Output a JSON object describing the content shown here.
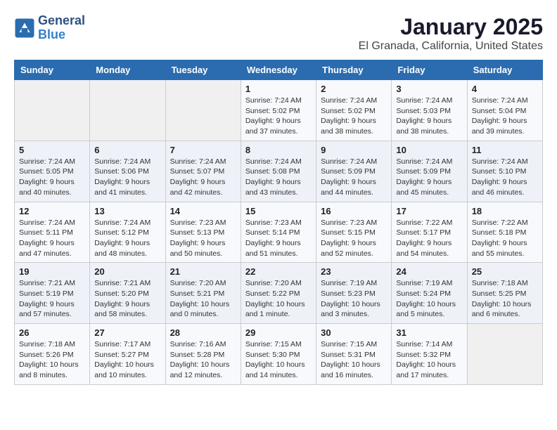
{
  "header": {
    "logo_line1": "General",
    "logo_line2": "Blue",
    "month": "January 2025",
    "location": "El Granada, California, United States"
  },
  "weekdays": [
    "Sunday",
    "Monday",
    "Tuesday",
    "Wednesday",
    "Thursday",
    "Friday",
    "Saturday"
  ],
  "weeks": [
    [
      {
        "day": "",
        "info": ""
      },
      {
        "day": "",
        "info": ""
      },
      {
        "day": "",
        "info": ""
      },
      {
        "day": "1",
        "info": "Sunrise: 7:24 AM\nSunset: 5:02 PM\nDaylight: 9 hours\nand 37 minutes."
      },
      {
        "day": "2",
        "info": "Sunrise: 7:24 AM\nSunset: 5:02 PM\nDaylight: 9 hours\nand 38 minutes."
      },
      {
        "day": "3",
        "info": "Sunrise: 7:24 AM\nSunset: 5:03 PM\nDaylight: 9 hours\nand 38 minutes."
      },
      {
        "day": "4",
        "info": "Sunrise: 7:24 AM\nSunset: 5:04 PM\nDaylight: 9 hours\nand 39 minutes."
      }
    ],
    [
      {
        "day": "5",
        "info": "Sunrise: 7:24 AM\nSunset: 5:05 PM\nDaylight: 9 hours\nand 40 minutes."
      },
      {
        "day": "6",
        "info": "Sunrise: 7:24 AM\nSunset: 5:06 PM\nDaylight: 9 hours\nand 41 minutes."
      },
      {
        "day": "7",
        "info": "Sunrise: 7:24 AM\nSunset: 5:07 PM\nDaylight: 9 hours\nand 42 minutes."
      },
      {
        "day": "8",
        "info": "Sunrise: 7:24 AM\nSunset: 5:08 PM\nDaylight: 9 hours\nand 43 minutes."
      },
      {
        "day": "9",
        "info": "Sunrise: 7:24 AM\nSunset: 5:09 PM\nDaylight: 9 hours\nand 44 minutes."
      },
      {
        "day": "10",
        "info": "Sunrise: 7:24 AM\nSunset: 5:09 PM\nDaylight: 9 hours\nand 45 minutes."
      },
      {
        "day": "11",
        "info": "Sunrise: 7:24 AM\nSunset: 5:10 PM\nDaylight: 9 hours\nand 46 minutes."
      }
    ],
    [
      {
        "day": "12",
        "info": "Sunrise: 7:24 AM\nSunset: 5:11 PM\nDaylight: 9 hours\nand 47 minutes."
      },
      {
        "day": "13",
        "info": "Sunrise: 7:24 AM\nSunset: 5:12 PM\nDaylight: 9 hours\nand 48 minutes."
      },
      {
        "day": "14",
        "info": "Sunrise: 7:23 AM\nSunset: 5:13 PM\nDaylight: 9 hours\nand 50 minutes."
      },
      {
        "day": "15",
        "info": "Sunrise: 7:23 AM\nSunset: 5:14 PM\nDaylight: 9 hours\nand 51 minutes."
      },
      {
        "day": "16",
        "info": "Sunrise: 7:23 AM\nSunset: 5:15 PM\nDaylight: 9 hours\nand 52 minutes."
      },
      {
        "day": "17",
        "info": "Sunrise: 7:22 AM\nSunset: 5:17 PM\nDaylight: 9 hours\nand 54 minutes."
      },
      {
        "day": "18",
        "info": "Sunrise: 7:22 AM\nSunset: 5:18 PM\nDaylight: 9 hours\nand 55 minutes."
      }
    ],
    [
      {
        "day": "19",
        "info": "Sunrise: 7:21 AM\nSunset: 5:19 PM\nDaylight: 9 hours\nand 57 minutes."
      },
      {
        "day": "20",
        "info": "Sunrise: 7:21 AM\nSunset: 5:20 PM\nDaylight: 9 hours\nand 58 minutes."
      },
      {
        "day": "21",
        "info": "Sunrise: 7:20 AM\nSunset: 5:21 PM\nDaylight: 10 hours\nand 0 minutes."
      },
      {
        "day": "22",
        "info": "Sunrise: 7:20 AM\nSunset: 5:22 PM\nDaylight: 10 hours\nand 1 minute."
      },
      {
        "day": "23",
        "info": "Sunrise: 7:19 AM\nSunset: 5:23 PM\nDaylight: 10 hours\nand 3 minutes."
      },
      {
        "day": "24",
        "info": "Sunrise: 7:19 AM\nSunset: 5:24 PM\nDaylight: 10 hours\nand 5 minutes."
      },
      {
        "day": "25",
        "info": "Sunrise: 7:18 AM\nSunset: 5:25 PM\nDaylight: 10 hours\nand 6 minutes."
      }
    ],
    [
      {
        "day": "26",
        "info": "Sunrise: 7:18 AM\nSunset: 5:26 PM\nDaylight: 10 hours\nand 8 minutes."
      },
      {
        "day": "27",
        "info": "Sunrise: 7:17 AM\nSunset: 5:27 PM\nDaylight: 10 hours\nand 10 minutes."
      },
      {
        "day": "28",
        "info": "Sunrise: 7:16 AM\nSunset: 5:28 PM\nDaylight: 10 hours\nand 12 minutes."
      },
      {
        "day": "29",
        "info": "Sunrise: 7:15 AM\nSunset: 5:30 PM\nDaylight: 10 hours\nand 14 minutes."
      },
      {
        "day": "30",
        "info": "Sunrise: 7:15 AM\nSunset: 5:31 PM\nDaylight: 10 hours\nand 16 minutes."
      },
      {
        "day": "31",
        "info": "Sunrise: 7:14 AM\nSunset: 5:32 PM\nDaylight: 10 hours\nand 17 minutes."
      },
      {
        "day": "",
        "info": ""
      }
    ]
  ]
}
